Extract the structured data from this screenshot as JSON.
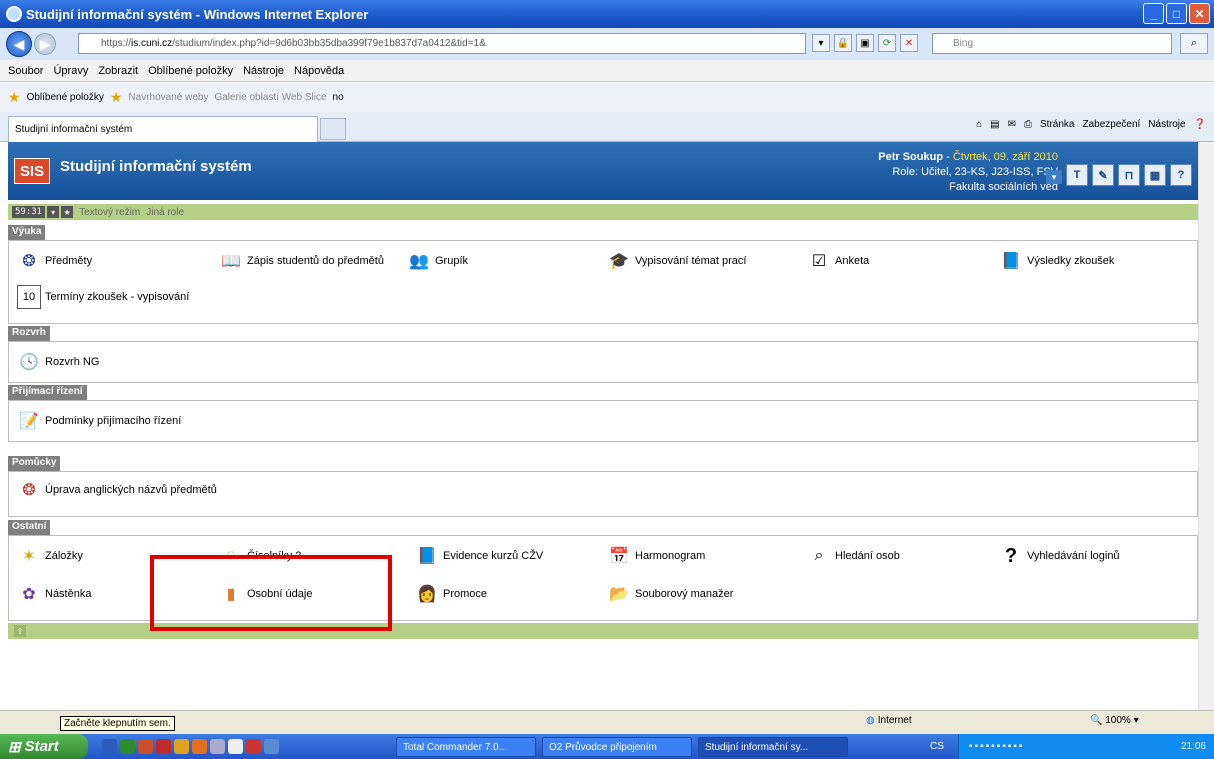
{
  "window": {
    "title": "Studijní informační systém - Windows Internet Explorer"
  },
  "address": {
    "url_prefix": "https://",
    "url_host": "is.cuni.cz",
    "url_path": "/studium/index.php?id=9d6b03bb35dba399f79e1b837d7a0412&tid=1&",
    "search_placeholder": "Bing"
  },
  "menu": [
    "Soubor",
    "Úpravy",
    "Zobrazit",
    "Oblíbené položky",
    "Nástroje",
    "Nápověda"
  ],
  "favorites": {
    "label": "Oblíbené položky",
    "suggested": "Navrhované weby",
    "gallery": "Galerie oblastí Web Slice",
    "no": "no"
  },
  "tab": {
    "title": "Studijní informační systém"
  },
  "commands": {
    "page": "Stránka",
    "security": "Zabezpečení",
    "tools": "Nástroje"
  },
  "sis": {
    "logo": "SIS",
    "title": "Studijní informační systém",
    "user": "Petr Soukup",
    "date": "Čtvrtek, 09. září 2010",
    "role": "Role: Učitel, 23-KS, J23-ISS, FSV",
    "faculty": "Fakulta sociálních věd",
    "timer": "59:31",
    "text_mode": "Textový režim",
    "other_role": "Jiná role"
  },
  "sections": {
    "vyuka": {
      "label": "Výuka",
      "items": [
        "Předměty",
        "Zápis studentů do předmětů",
        "Grupík",
        "Vypisování témat prací",
        "Anketa",
        "Výsledky zkoušek",
        "Termíny zkoušek - vypisování"
      ]
    },
    "rozvrh": {
      "label": "Rozvrh",
      "items": [
        "Rozvrh NG"
      ]
    },
    "prijimaci": {
      "label": "Přijímací řízení",
      "items": [
        "Podmínky přijímacího řízení"
      ]
    },
    "pomucky": {
      "label": "Pomůcky",
      "items": [
        "Úprava anglických názvů předmětů"
      ]
    },
    "ostatni": {
      "label": "Ostatní",
      "items": [
        "Záložky",
        "Číselníky 2",
        "Evidence kurzů CŽV",
        "Harmonogram",
        "Hledání osob",
        "Vyhledávání loginů",
        "Nástěnka",
        "Osobní údaje",
        "Promoce",
        "Souborový manažer"
      ]
    }
  },
  "status": {
    "tooltip": "Začněte klepnutím sem.",
    "zone": "Internet",
    "zoom": "100%"
  },
  "taskbar": {
    "start": "Start",
    "tasks": [
      "Total Commander 7.0...",
      "O2 Průvodce připojením",
      "Studijní informační sy..."
    ],
    "lang": "CS",
    "clock": "21:06"
  },
  "colors": {
    "highlight": "#e00000",
    "header": "#1f5fa8",
    "green_bar": "#b6cf86"
  }
}
